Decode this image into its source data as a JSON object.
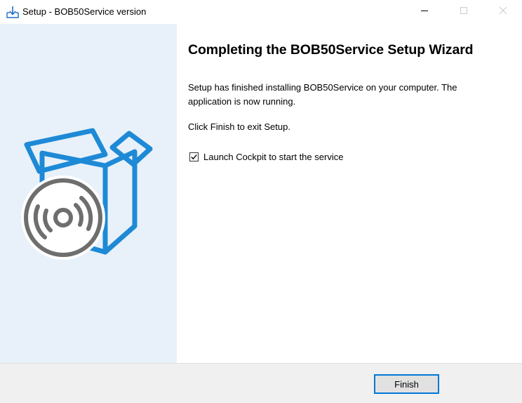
{
  "window": {
    "title": "Setup - BOB50Service version",
    "icon": "setup-installer-icon"
  },
  "caption_buttons": {
    "minimize_icon": "minimize-icon",
    "maximize_icon": "maximize-icon",
    "close_icon": "close-icon"
  },
  "banner": {
    "icon": "software-box-disc-icon",
    "colors": {
      "background": "#e8f1f9",
      "box_stroke": "#1e8ad6",
      "disc_stroke": "#6e6e6e"
    }
  },
  "content": {
    "heading": "Completing the BOB50Service Setup Wizard",
    "paragraph_1": "Setup has finished installing BOB50Service on your computer. The application is now running.",
    "paragraph_2": "Click Finish to exit Setup.",
    "launch_checkbox": {
      "label": "Launch Cockpit to start the service",
      "checked": true
    }
  },
  "footer": {
    "finish_label": "Finish",
    "accent": "#0078d7"
  }
}
